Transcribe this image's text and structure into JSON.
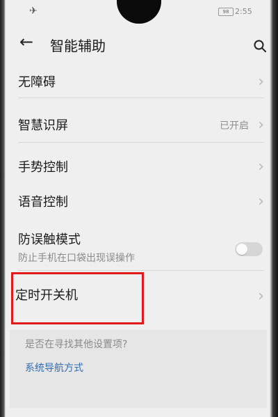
{
  "status_bar": {
    "battery": "98",
    "time": "2:55"
  },
  "header": {
    "title": "智能辅助"
  },
  "icons": {
    "airplane": "airplane-icon",
    "back": "back-arrow-icon",
    "search": "search-icon",
    "chevron": "chevron-right-icon"
  },
  "settings": {
    "items": [
      {
        "label": "无障碍"
      },
      {
        "label": "智慧识屏",
        "value": "已开启"
      },
      {
        "label": "手势控制"
      },
      {
        "label": "语音控制"
      },
      {
        "label": "防误触模式",
        "subtitle": "防止手机在口袋出现误操作",
        "toggle_on": false
      },
      {
        "label": "定时开关机"
      }
    ]
  },
  "suggestion": {
    "question": "是否在寻找其他设置项?",
    "link": "系统导航方式"
  },
  "colors": {
    "highlight": "#e01919",
    "link": "#2f6db5",
    "background": "#efefef"
  }
}
